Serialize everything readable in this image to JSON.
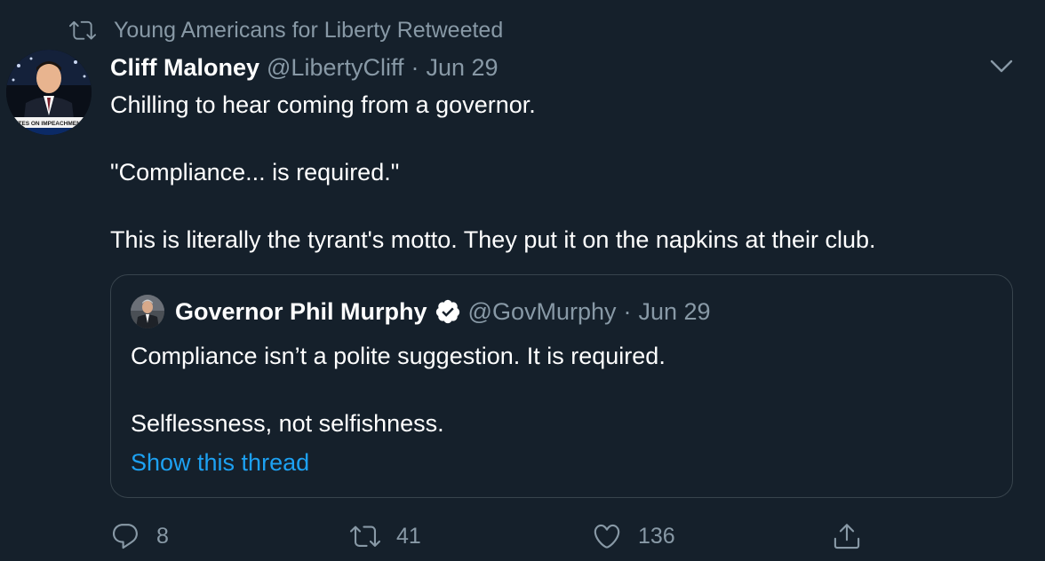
{
  "retweet_context": {
    "icon": "retweet-icon",
    "text": "Young Americans for Liberty Retweeted"
  },
  "tweet": {
    "author_name": "Cliff Maloney",
    "author_handle": "@LibertyCliff",
    "separator": "·",
    "date": "Jun 29",
    "text_lines": [
      "Chilling to hear coming from a governor.",
      "\"Compliance... is required.\"",
      "This is literally the tyrant's motto. They put it on the napkins at their club."
    ],
    "avatar_caption": "VOTES ON IMPEACHMENT A"
  },
  "quoted_tweet": {
    "author_name": "Governor Phil Murphy",
    "verified": true,
    "author_handle": "@GovMurphy",
    "separator": "·",
    "date": "Jun 29",
    "text_lines": [
      "Compliance isn’t a polite suggestion. It is required.",
      "Selflessness, not selfishness."
    ],
    "show_thread_label": "Show this thread"
  },
  "actions": {
    "reply_count": "8",
    "retweet_count": "41",
    "like_count": "136"
  },
  "colors": {
    "background": "#15202b",
    "secondary_text": "#8899a6",
    "link": "#1da1f2",
    "border": "#38444d"
  }
}
